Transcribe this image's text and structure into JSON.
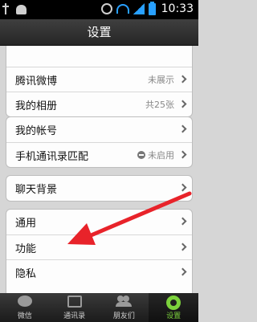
{
  "status_bar": {
    "time": "10:33",
    "icons": [
      "usb-icon",
      "android-icon",
      "alarm-icon",
      "wifi-icon",
      "signal-icon",
      "battery-icon"
    ]
  },
  "header": {
    "title": "设置"
  },
  "settings": {
    "group1": [
      {
        "label": "腾讯微博",
        "value": "未展示"
      },
      {
        "label": "我的相册",
        "value": "共25张"
      }
    ],
    "group2": [
      {
        "label": "我的帐号",
        "value": ""
      },
      {
        "label": "手机通讯录匹配",
        "value": "未启用"
      }
    ],
    "group3": [
      {
        "label": "聊天背景",
        "value": ""
      }
    ],
    "group4": [
      {
        "label": "通用",
        "value": ""
      },
      {
        "label": "功能",
        "value": ""
      },
      {
        "label": "隐私",
        "value": ""
      }
    ]
  },
  "annotation": {
    "color": "#e8232a"
  },
  "tabs": [
    {
      "label": "微信",
      "icon": "chat-bubble-icon",
      "active": false
    },
    {
      "label": "通讯录",
      "icon": "contacts-icon",
      "active": false
    },
    {
      "label": "朋友们",
      "icon": "friends-icon",
      "active": false
    },
    {
      "label": "设置",
      "icon": "gear-icon",
      "active": true
    }
  ],
  "colors": {
    "active_tab": "#7cd23c",
    "header_bg": "#2f2f2f"
  }
}
